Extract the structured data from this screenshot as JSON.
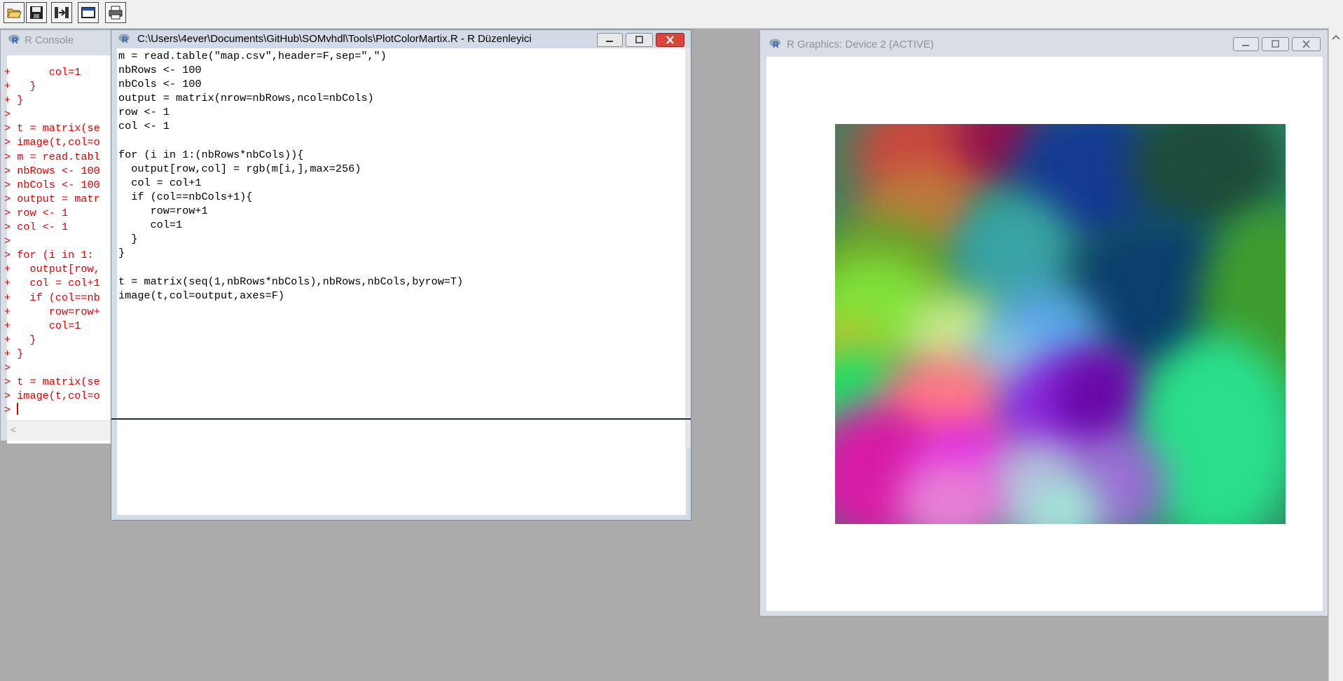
{
  "toolbar": {
    "buttons": [
      "open-script-button",
      "save-button",
      "load-workspace-button",
      "new-window-button",
      "print-button"
    ]
  },
  "console": {
    "title": "R Console",
    "lines": [
      "+      col=1",
      "+   }",
      "+ }",
      ">",
      "> t = matrix(se",
      "> image(t,col=o",
      "> m = read.tabl",
      "> nbRows <- 100",
      "> nbCols <- 100",
      "> output = matr",
      "> row <- 1",
      "> col <- 1",
      ">",
      "> for (i in 1:",
      "+   output[row,",
      "+   col = col+1",
      "+   if (col==nb",
      "+      row=row+",
      "+      col=1",
      "+   }",
      "+ }",
      ">",
      "> t = matrix(se",
      "> image(t,col=o",
      "> "
    ],
    "scroll_left_glyph": "<"
  },
  "editor": {
    "title": "C:\\Users\\4ever\\Documents\\GitHub\\SOMvhdl\\Tools\\PlotColorMartix.R - R Düzenleyici",
    "code": "m = read.table(\"map.csv\",header=F,sep=\",\")\nnbRows <- 100\nnbCols <- 100\noutput = matrix(nrow=nbRows,ncol=nbCols)\nrow <- 1\ncol <- 1\n\nfor (i in 1:(nbRows*nbCols)){\n  output[row,col] = rgb(m[i,],max=256)\n  col = col+1\n  if (col==nbCols+1){\n     row=row+1\n     col=1\n  }\n}\n\nt = matrix(seq(1,nbRows*nbCols),nbRows,nbCols,byrow=T)\nimage(t,col=output,axes=F)"
  },
  "graphics": {
    "title": "R Graphics: Device 2 (ACTIVE)"
  },
  "colors": {
    "console_text": "#e00000",
    "desktop": "#ababab",
    "close_button": "#d9463a"
  }
}
